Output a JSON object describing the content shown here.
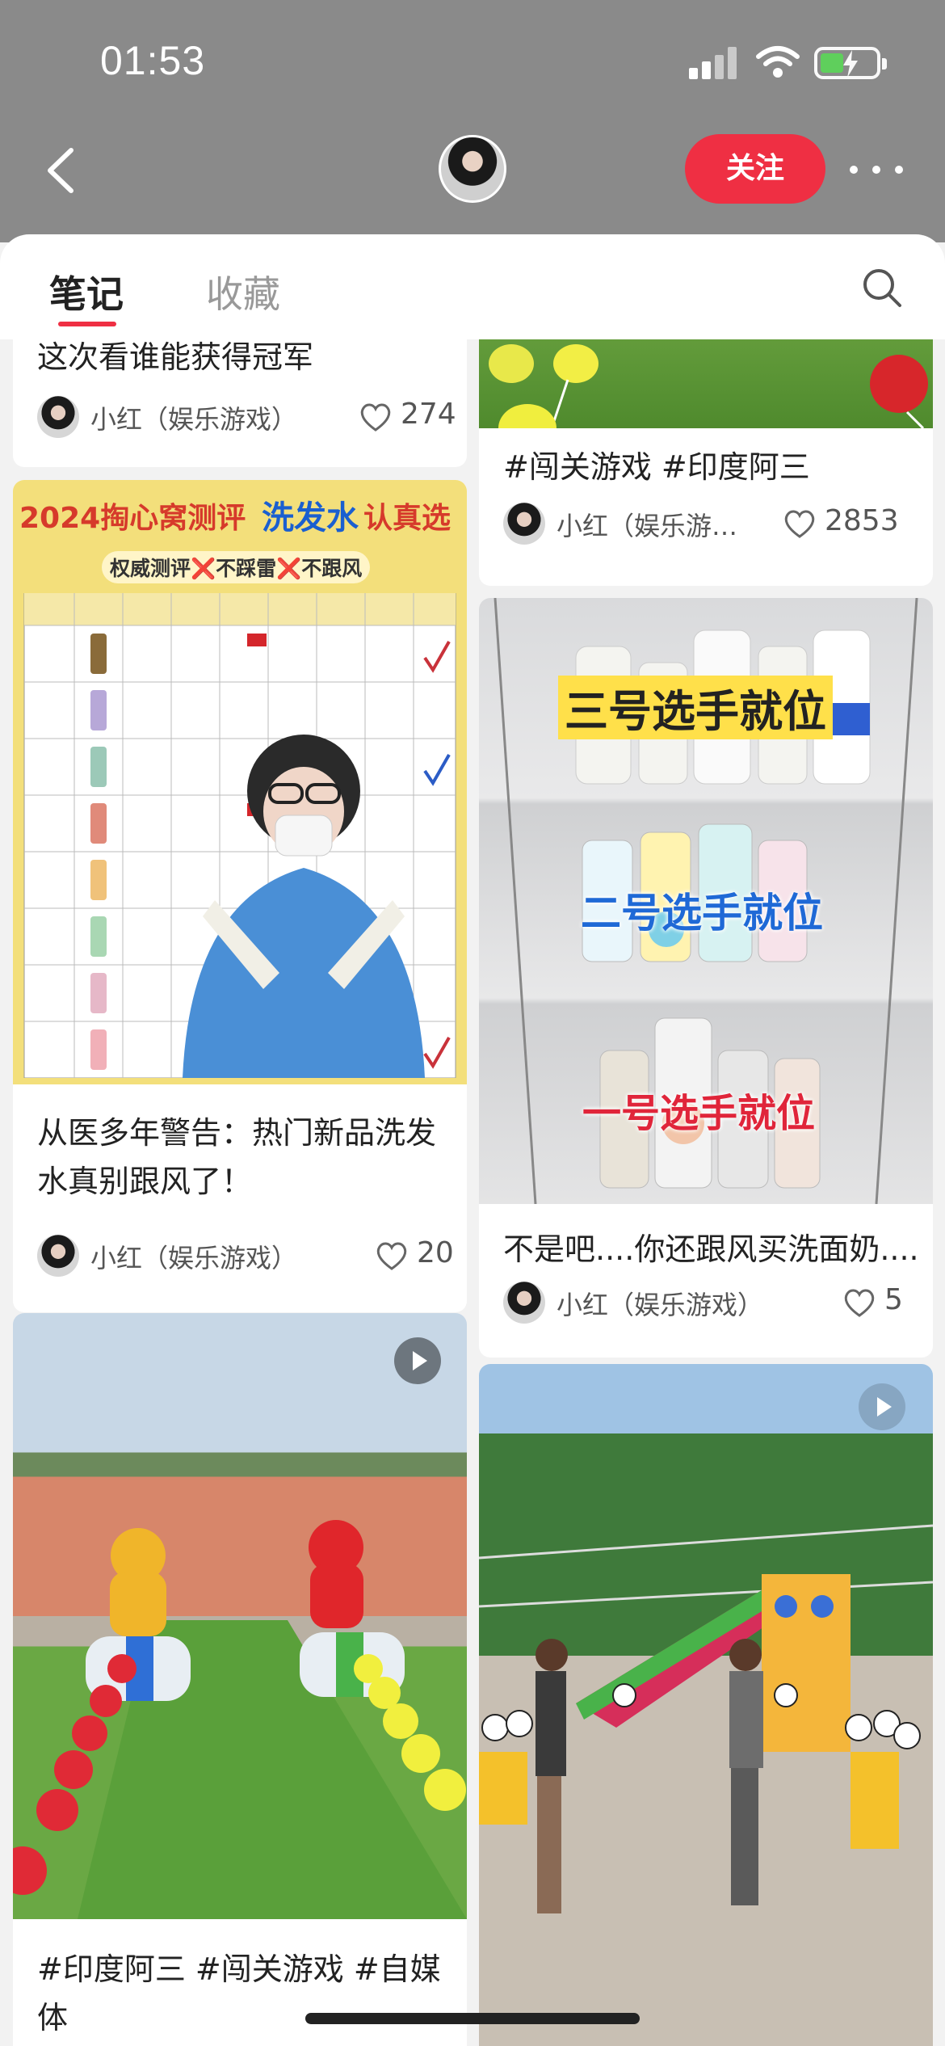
{
  "status_bar": {
    "time": "01:53"
  },
  "header": {
    "follow_label": "关注"
  },
  "tabs": [
    {
      "label": "笔记"
    },
    {
      "label": "收藏"
    }
  ],
  "colors": {
    "accent": "#ef2f43",
    "header_bg": "#8a8a8a"
  },
  "cards": [
    {
      "title": "这次看谁能获得冠军",
      "author": "小红（娱乐游戏）",
      "likes": "274"
    },
    {
      "title": "#闯关游戏 #印度阿三",
      "author": "小红（娱乐游戏）",
      "likes": "2853"
    },
    {
      "title": "从医多年警告：热门新品洗发水真别跟风了！",
      "author": "小红（娱乐游戏）",
      "likes": "20",
      "cover_text": {
        "headline_a": "2024掏心窝测评",
        "headline_b": "洗发水",
        "headline_c": "认真选",
        "subline": "权威测评❌不踩雷❌不跟风"
      }
    },
    {
      "title": "不是吧....你还跟风买洗面奶....",
      "author": "小红（娱乐游戏）",
      "likes": "5",
      "cover_text": {
        "line1": "三号选手就位",
        "line2": "二号选手就位",
        "line3": "一号选手就位"
      }
    },
    {
      "title": "#印度阿三 #闯关游戏 #自媒体"
    },
    {
      "title": ""
    }
  ]
}
